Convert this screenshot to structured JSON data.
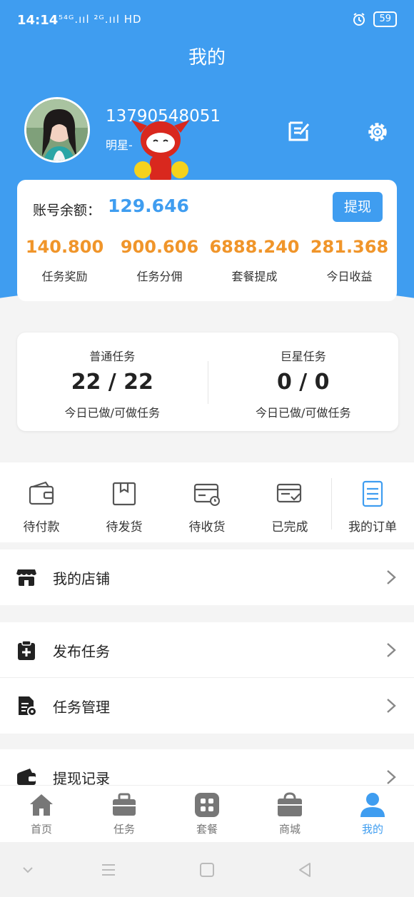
{
  "status": {
    "time": "14:14",
    "signal": "⁵⁴ᴳ.ııl ²ᴳ.ııl HD",
    "battery": "59",
    "alarm_icon": "alarm-clock-icon"
  },
  "header": {
    "title": "我的",
    "phone": "13790548051",
    "nickname": "明星-",
    "edit_icon": "edit-note-icon",
    "settings_icon": "gear-icon"
  },
  "balance": {
    "label": "账号余额：",
    "value": "129.646",
    "withdraw_label": "提现",
    "stats": [
      {
        "value": "140.800",
        "label": "任务奖励"
      },
      {
        "value": "900.606",
        "label": "任务分佣"
      },
      {
        "value": "6888.240",
        "label": "套餐提成"
      },
      {
        "value": "281.368",
        "label": "今日收益"
      }
    ]
  },
  "tasks": [
    {
      "name": "普通任务",
      "value": "22 / 22",
      "sub": "今日已做/可做任务"
    },
    {
      "name": "巨星任务",
      "value": "0 / 0",
      "sub": "今日已做/可做任务"
    }
  ],
  "orders": [
    {
      "label": "待付款",
      "icon": "wallet-icon"
    },
    {
      "label": "待发货",
      "icon": "box-icon"
    },
    {
      "label": "待收货",
      "icon": "card-clock-icon"
    },
    {
      "label": "已完成",
      "icon": "card-check-icon"
    },
    {
      "label": "我的订单",
      "icon": "document-icon"
    }
  ],
  "menu": [
    {
      "label": "我的店铺",
      "icon": "shop-icon"
    },
    {
      "label": "发布任务",
      "icon": "clipboard-plus-icon"
    },
    {
      "label": "任务管理",
      "icon": "file-gear-icon"
    },
    {
      "label": "提现记录",
      "icon": "wallet-record-icon"
    }
  ],
  "tabs": [
    {
      "label": "首页",
      "icon": "home-icon"
    },
    {
      "label": "任务",
      "icon": "briefcase-icon"
    },
    {
      "label": "套餐",
      "icon": "grid-icon"
    },
    {
      "label": "商城",
      "icon": "shop-bag-icon"
    },
    {
      "label": "我的",
      "icon": "user-icon",
      "active": true
    }
  ],
  "colors": {
    "primary": "#3f9df0",
    "accent_orange": "#f0952a",
    "icon_gray": "#777777"
  }
}
